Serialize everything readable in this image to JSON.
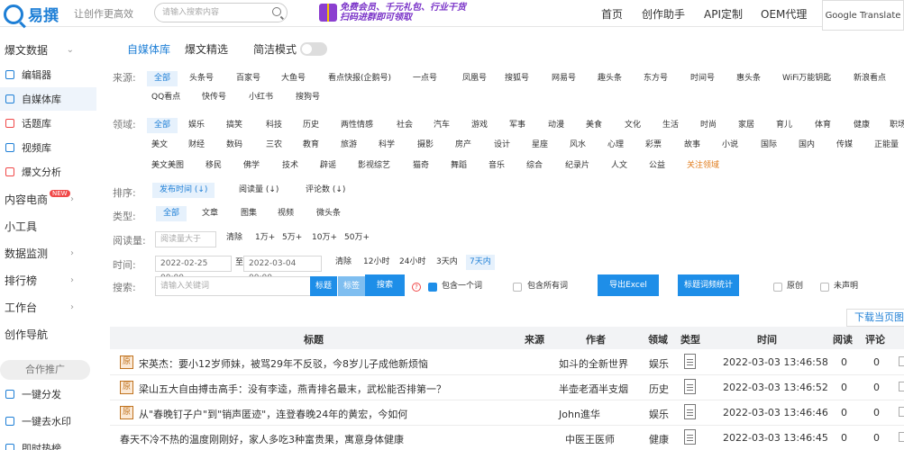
{
  "header": {
    "logo": "易撰",
    "slogan": "让创作更高效",
    "search_placeholder": "请输入搜索内容",
    "banner_line1": "免费会员、千元礼包、行业干货",
    "banner_line2": "扫码进群即可领取",
    "nav": [
      "首页",
      "创作助手",
      "API定制",
      "OEM代理"
    ],
    "translate": "Google Translate"
  },
  "sidebar": {
    "group1": "爆文数据",
    "items1": [
      "编辑器",
      "自媒体库",
      "话题库",
      "视频库",
      "爆文分析"
    ],
    "groups": [
      "内容电商",
      "小工具",
      "数据监测",
      "排行榜",
      "工作台",
      "创作导航"
    ],
    "badge": "NEW",
    "promo": "合作推广",
    "items2": [
      "一键分发",
      "一键去水印",
      "即时热榜"
    ]
  },
  "tabs": {
    "t1": "自媒体库",
    "t2": "爆文精选",
    "t3": "简洁模式"
  },
  "filters": {
    "source_label": "来源:",
    "source_row1": [
      "全部",
      "头条号",
      "百家号",
      "大鱼号",
      "看点快报(企鹅号)",
      "一点号",
      "凤凰号",
      "搜狐号",
      "网易号",
      "趣头条",
      "东方号",
      "时间号",
      "惠头条",
      "WiFi万能钥匙",
      "新浪看点"
    ],
    "source_row2": [
      "QQ看点",
      "快传号",
      "小红书",
      "搜狗号"
    ],
    "domain_label": "领域:",
    "domain_row1": [
      "全部",
      "娱乐",
      "搞笑",
      "科技",
      "历史",
      "两性情感",
      "社会",
      "汽车",
      "游戏",
      "军事",
      "动漫",
      "美食",
      "文化",
      "生活",
      "时尚",
      "家居",
      "育儿",
      "体育",
      "健康",
      "职场"
    ],
    "domain_row2": [
      "美文",
      "财经",
      "数码",
      "三农",
      "教育",
      "旅游",
      "科学",
      "摄影",
      "房产",
      "设计",
      "星座",
      "风水",
      "心理",
      "彩票",
      "故事",
      "小说",
      "国际",
      "国内",
      "传媒",
      "正能量"
    ],
    "domain_row3": [
      "美文美图",
      "移民",
      "佛学",
      "技术",
      "辟谣",
      "影视综艺",
      "猫奇",
      "舞蹈",
      "音乐",
      "综合",
      "纪录片",
      "人文",
      "公益",
      "关注领域"
    ],
    "sort_label": "排序:",
    "sort": [
      "发布时间 (↓)",
      "阅读量 (↓)",
      "评论数 (↓)"
    ],
    "type_label": "类型:",
    "types": [
      "全部",
      "文章",
      "图集",
      "视频",
      "微头条"
    ],
    "read_label": "阅读量:",
    "read_placeholder": "阅读量大于",
    "read_opts": [
      "清除",
      "1万+",
      "5万+",
      "10万+",
      "50万+"
    ],
    "time_label": "时间:",
    "time_from": "2022-02-25 00:00",
    "time_to": "2022-03-04 00:00",
    "time_sep": "至",
    "time_opts": [
      "清除",
      "12小时",
      "24小时",
      "3天内",
      "7天内"
    ],
    "search_label": "搜索:",
    "search_placeholder": "请输入关键词",
    "seg": [
      "标题",
      "标签"
    ],
    "search_btn": "搜索",
    "include_one": "包含一个词",
    "include_all": "包含所有词",
    "export_btn": "导出Excel",
    "stat_btn": "标题词频统计",
    "original": "原创",
    "undeclared": "未声明"
  },
  "download": "下载当页图片",
  "table": {
    "headers": [
      "标题",
      "来源",
      "作者",
      "领域",
      "类型",
      "时间",
      "阅读",
      "评论"
    ],
    "rows": [
      {
        "orig": "原",
        "title": "宋英杰：要小12岁师妹，被骂29年不反驳，今8岁儿子成他新烦恼",
        "author": "如斗的全新世界",
        "field": "娱乐",
        "time": "2022-03-03 13:46:58",
        "read": "0",
        "comment": "0"
      },
      {
        "orig": "原",
        "title": "梁山五大自由搏击高手：没有李逵，燕青排名最末，武松能否排第一？",
        "author": "半壶老酒半支烟",
        "field": "历史",
        "time": "2022-03-03 13:46:52",
        "read": "0",
        "comment": "0"
      },
      {
        "orig": "原",
        "title": "从\"春晚钉子户\"到\"销声匿迹\"，连登春晚24年的黄宏，今如何",
        "author": "John進华",
        "field": "娱乐",
        "time": "2022-03-03 13:46:46",
        "read": "0",
        "comment": "0"
      },
      {
        "orig": "",
        "title": "春天不冷不热的温度刚刚好，家人多吃3种富贵果，寓意身体健康",
        "author": "中医王医师",
        "field": "健康",
        "time": "2022-03-03 13:46:45",
        "read": "0",
        "comment": "0"
      }
    ]
  }
}
